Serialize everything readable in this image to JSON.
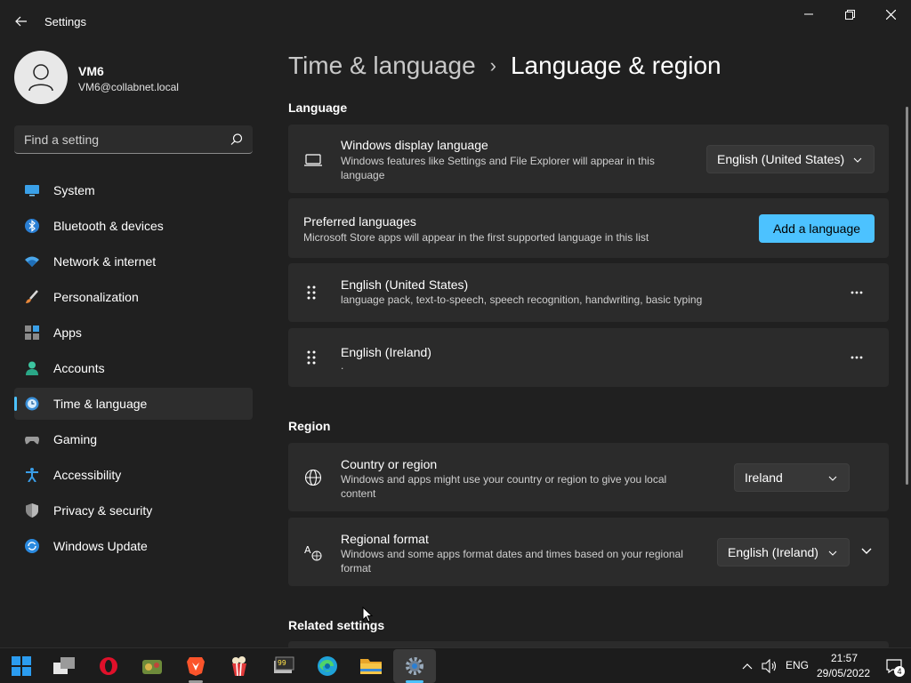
{
  "window": {
    "title": "Settings"
  },
  "user": {
    "name": "VM6",
    "email": "VM6@collabnet.local"
  },
  "search": {
    "placeholder": "Find a setting"
  },
  "nav": {
    "items": [
      {
        "label": "System"
      },
      {
        "label": "Bluetooth & devices"
      },
      {
        "label": "Network & internet"
      },
      {
        "label": "Personalization"
      },
      {
        "label": "Apps"
      },
      {
        "label": "Accounts"
      },
      {
        "label": "Time & language"
      },
      {
        "label": "Gaming"
      },
      {
        "label": "Accessibility"
      },
      {
        "label": "Privacy & security"
      },
      {
        "label": "Windows Update"
      }
    ],
    "selected": "Time & language"
  },
  "breadcrumb": {
    "parent": "Time & language",
    "separator": "›",
    "current": "Language & region"
  },
  "language_section": {
    "heading": "Language",
    "display_language": {
      "title": "Windows display language",
      "desc": "Windows features like Settings and File Explorer will appear in this language",
      "value": "English (United States)"
    },
    "preferred": {
      "title": "Preferred languages",
      "desc": "Microsoft Store apps will appear in the first supported language in this list",
      "button": "Add a language"
    },
    "languages": [
      {
        "name": "English (United States)",
        "features": "language pack, text-to-speech, speech recognition, handwriting, basic typing"
      },
      {
        "name": "English (Ireland)",
        "features": "."
      }
    ]
  },
  "region_section": {
    "heading": "Region",
    "country": {
      "title": "Country or region",
      "desc": "Windows and apps might use your country or region to give you local content",
      "value": "Ireland"
    },
    "format": {
      "title": "Regional format",
      "desc": "Windows and some apps format dates and times based on your regional format",
      "value": "English (Ireland)"
    }
  },
  "related": {
    "heading": "Related settings"
  },
  "taskbar": {
    "tray": {
      "language": "ENG",
      "time": "21:57",
      "date": "29/05/2022",
      "notifications": "4"
    }
  },
  "colors": {
    "accent": "#4cc2ff",
    "background": "#202020",
    "card": "#2b2b2b"
  }
}
